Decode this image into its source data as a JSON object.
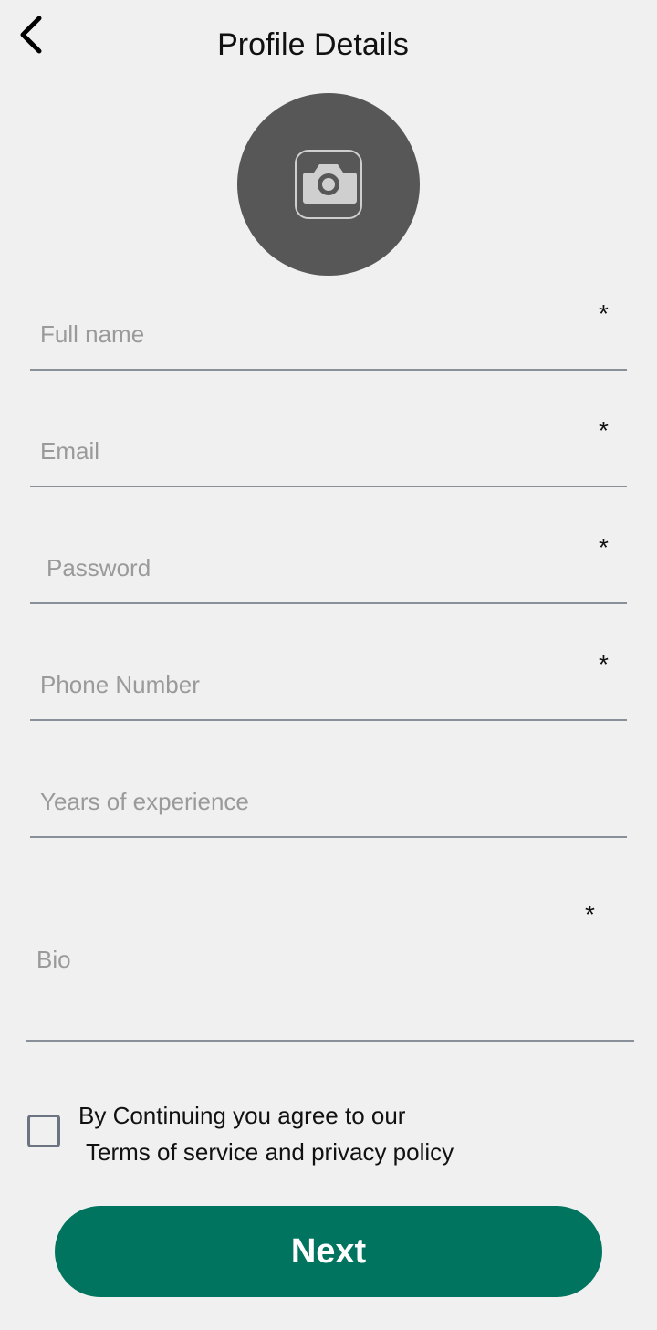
{
  "header": {
    "title": "Profile Details",
    "back_icon": "chevron-left-icon"
  },
  "avatar": {
    "icon": "camera-icon",
    "background": "#575757"
  },
  "form": {
    "full_name": {
      "placeholder": "Full name",
      "required_mark": "*"
    },
    "email": {
      "placeholder": "Email",
      "required_mark": "*"
    },
    "password": {
      "placeholder": "Password",
      "required_mark": "*"
    },
    "phone": {
      "placeholder": "Phone Number",
      "required_mark": "*"
    },
    "experience": {
      "placeholder": "Years of experience"
    },
    "bio": {
      "placeholder": "Bio",
      "required_mark": "*"
    }
  },
  "terms": {
    "line1": "By Continuing you agree to our",
    "line2": "Terms of service and privacy policy",
    "checked": false
  },
  "next_button": {
    "label": "Next",
    "color": "#00745f"
  },
  "colors": {
    "background": "#f0f0f0",
    "underline": "#8a9099",
    "placeholder": "#9a9a9a"
  }
}
